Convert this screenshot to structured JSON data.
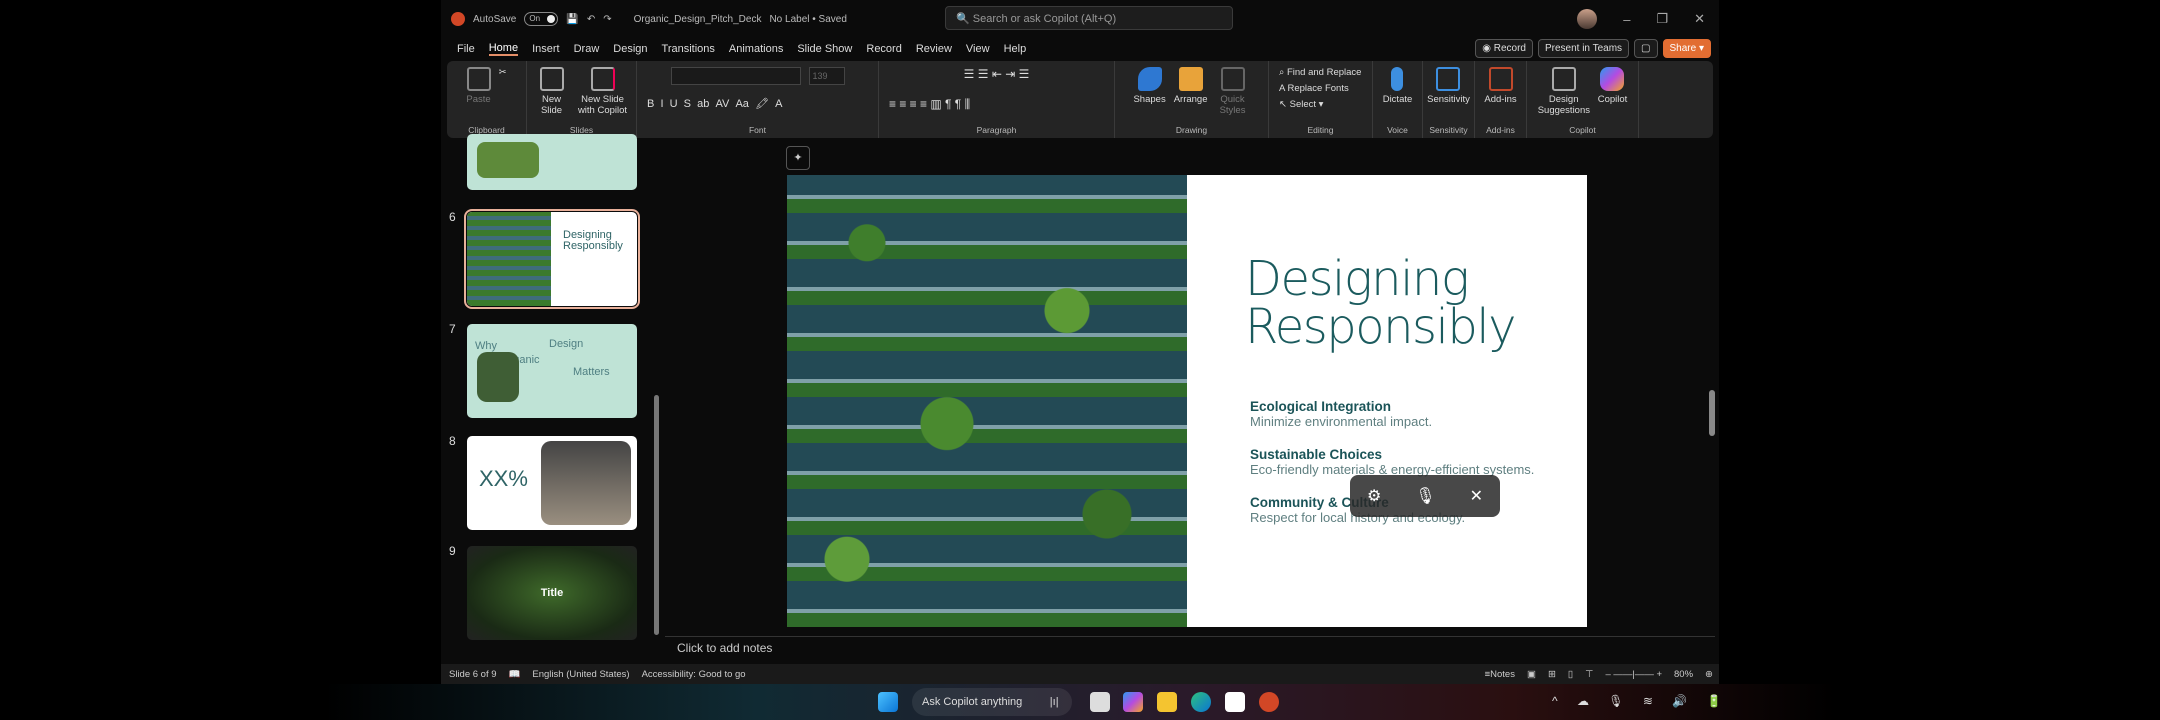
{
  "titlebar": {
    "autosave": "AutoSave",
    "toggle": "On",
    "filename": "Organic_Design_Pitch_Deck",
    "label": "No Label • Saved",
    "search_placeholder": "Search or ask Copilot (Alt+Q)"
  },
  "tabs": [
    "File",
    "Home",
    "Insert",
    "Draw",
    "Design",
    "Transitions",
    "Animations",
    "Slide Show",
    "Record",
    "Review",
    "View",
    "Help"
  ],
  "actions": {
    "record": "Record",
    "present": "Present in Teams",
    "share": "Share"
  },
  "ribbon": {
    "clipboard": {
      "label": "Clipboard",
      "paste": "Paste"
    },
    "slides": {
      "label": "Slides",
      "new_slide": "New Slide",
      "new_copilot": "New Slide with Copilot"
    },
    "font": {
      "label": "Font",
      "size": "139"
    },
    "paragraph": {
      "label": "Paragraph"
    },
    "drawing": {
      "label": "Drawing",
      "shapes": "Shapes",
      "arrange": "Arrange",
      "quick": "Quick Styles"
    },
    "editing": {
      "label": "Editing",
      "find": "Find and Replace",
      "replace": "Replace Fonts",
      "select": "Select"
    },
    "voice": {
      "label": "Voice",
      "dictate": "Dictate"
    },
    "sensitivity": {
      "label": "Sensitivity",
      "btn": "Sensitivity"
    },
    "addins": {
      "label": "Add-ins",
      "btn": "Add-ins"
    },
    "copilot": {
      "label": "Copilot",
      "design": "Design Suggestions",
      "copilot": "Copilot"
    }
  },
  "thumbnails": [
    {
      "num": "6"
    },
    {
      "num": "7",
      "t1": "Why",
      "t2": "Organic",
      "t3": "Design",
      "t4": "Matters"
    },
    {
      "num": "8",
      "big": "XX%"
    },
    {
      "num": "9",
      "title": "Title"
    }
  ],
  "slide": {
    "title1": "Designing",
    "title2": "Responsibly",
    "items": [
      {
        "h": "Ecological Integration",
        "d": "Minimize environmental impact."
      },
      {
        "h": "Sustainable Choices",
        "d": "Eco-friendly materials & energy-efficient systems."
      },
      {
        "h": "Community & Culture",
        "d": "Respect for local history and ecology."
      }
    ]
  },
  "notes": "Click to add notes",
  "status": {
    "slide": "Slide 6 of 9",
    "lang": "English (United States)",
    "access": "Accessibility: Good to go",
    "notes": "Notes",
    "zoom": "80%"
  },
  "taskbar": {
    "ask": "Ask Copilot anything"
  }
}
